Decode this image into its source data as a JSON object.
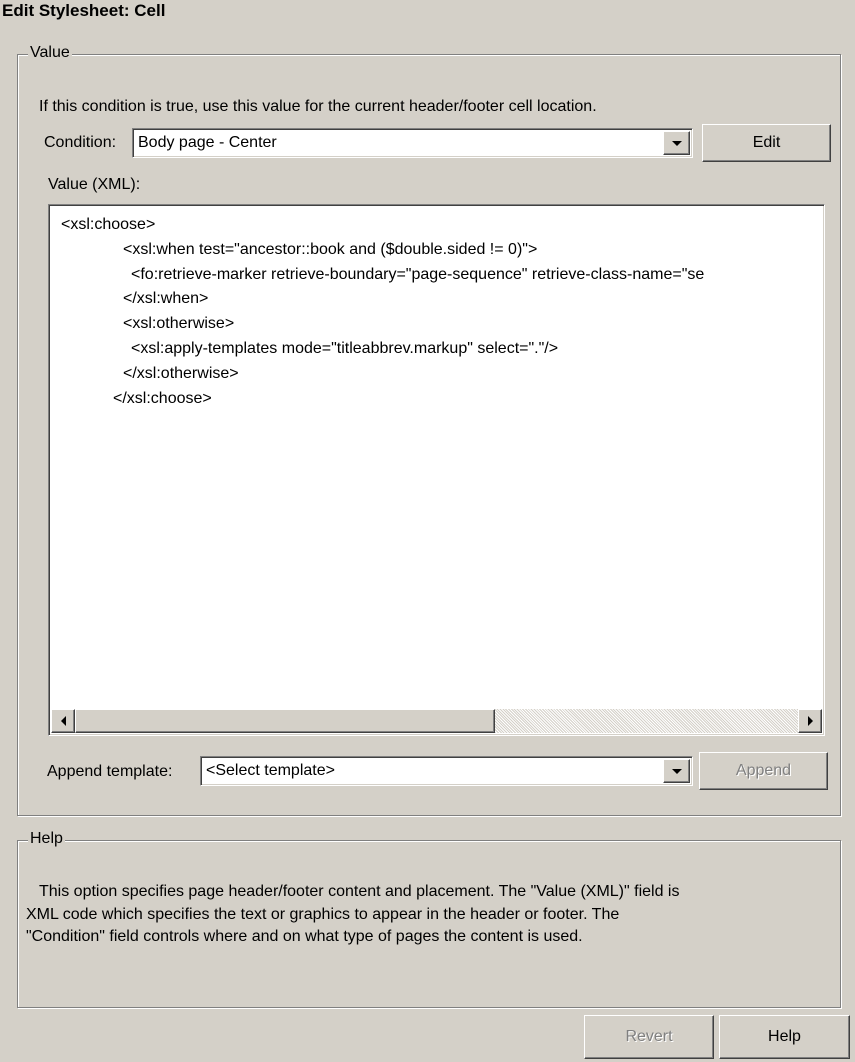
{
  "window": {
    "title": "Edit Stylesheet: Cell"
  },
  "value_group": {
    "legend": "Value",
    "instruction": "If this condition is true, use this value for the current header/footer cell location.",
    "condition_label": "Condition:",
    "condition_value": "Body page - Center",
    "edit_button": "Edit",
    "value_label": "Value (XML):",
    "xml_lines": [
      "<xsl:choose>",
      "<xsl:when test=\"ancestor::book and ($double.sided != 0)\">",
      "<fo:retrieve-marker retrieve-boundary=\"page-sequence\" retrieve-class-name=\"se",
      "</xsl:when>",
      "<xsl:otherwise>",
      "<xsl:apply-templates mode=\"titleabbrev.markup\" select=\".\"/>",
      "</xsl:otherwise>",
      "</xsl:choose>"
    ],
    "append_label": "Append template:",
    "append_value": "<Select template>",
    "append_button": "Append"
  },
  "help_group": {
    "legend": "Help",
    "lines": [
      "This option specifies page header/footer content and placement.  The \"Value (XML)\" field is",
      "XML code which specifies the text or graphics to appear in the header or footer.  The",
      "\"Condition\" field controls where and on what type of pages the content is used."
    ]
  },
  "footer": {
    "revert_button": "Revert",
    "help_button": "Help"
  },
  "icons": {
    "combo_arrow": "chevron-down-icon",
    "scroll_left": "arrow-left-icon",
    "scroll_right": "arrow-right-icon"
  }
}
